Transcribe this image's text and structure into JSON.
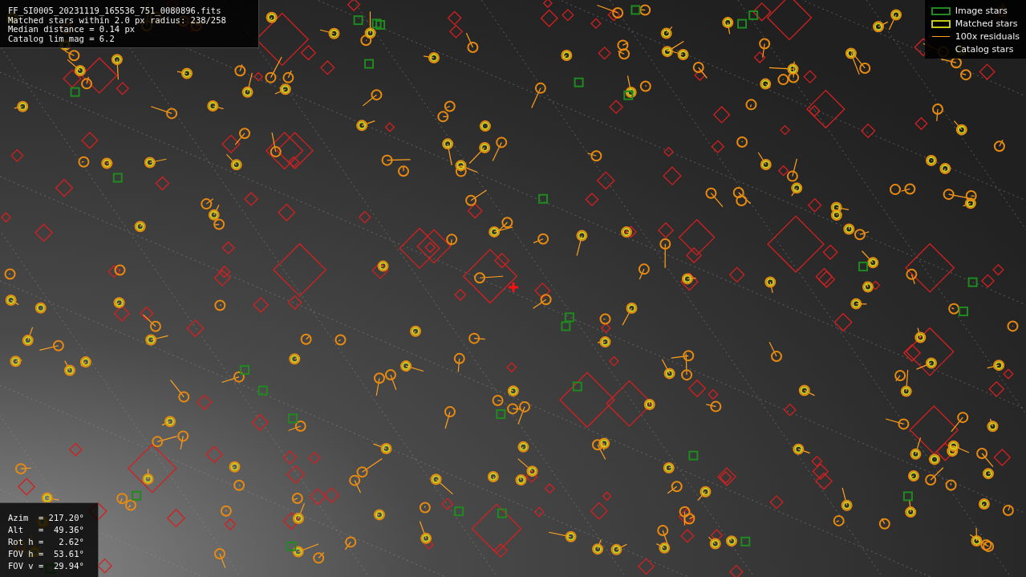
{
  "info_box": {
    "lines": [
      "FF_SI0005_20231119_165536_751_0080896.fits",
      "Matched stars within 2.0 px radius: 238/258",
      "Median distance = 0.14 px",
      "Catalog lim mag = 6.2"
    ]
  },
  "legend": [
    {
      "kind": "box",
      "color": "#1f8a1f",
      "label": "Image stars"
    },
    {
      "kind": "box",
      "color": "#c8c814",
      "label": "Matched stars"
    },
    {
      "kind": "line",
      "color": "#ffa020",
      "label": "100x residuals"
    },
    {
      "kind": "none",
      "label": "Catalog stars"
    }
  ],
  "pointing_box": {
    "lines": [
      "Azim  = 217.20°",
      "Alt   =  49.36°",
      "Rot h =   2.62°",
      "FOV h =  53.61°",
      "FOV v =  29.94°"
    ]
  }
}
